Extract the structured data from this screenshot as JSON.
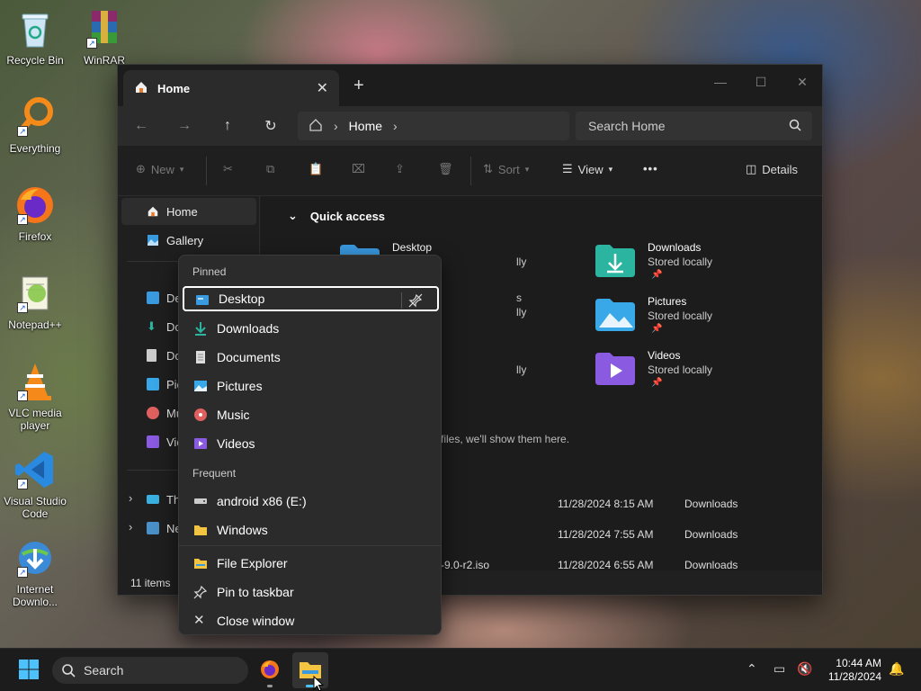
{
  "desktop": {
    "icons": [
      {
        "label": "Recycle Bin"
      },
      {
        "label": "WinRAR"
      },
      {
        "label": "Everything"
      },
      {
        "label": "Firefox"
      },
      {
        "label": "Notepad++"
      },
      {
        "label": "VLC media player"
      },
      {
        "label": "Visual Studio Code"
      },
      {
        "label": "Internet Downlo..."
      }
    ]
  },
  "explorer": {
    "tab_title": "Home",
    "new_tab": "+",
    "address_crumb": "Home",
    "search_placeholder": "Search Home",
    "toolbar": {
      "new_label": "New",
      "sort_label": "Sort",
      "view_label": "View",
      "more_label": "•••",
      "details_label": "Details"
    },
    "sidebar": {
      "home": "Home",
      "gallery": "Gallery",
      "items": [
        "De",
        "Do",
        "Do",
        "Pic",
        "Mu",
        "Vic"
      ],
      "this_pc": "Th",
      "network": "Ne"
    },
    "quick_access_label": "Quick access",
    "folders": [
      {
        "name": "Desktop",
        "sub": "lly"
      },
      {
        "name": "Downloads",
        "sub": "Stored locally"
      },
      {
        "name": "",
        "sub": "lly"
      },
      {
        "name": "Pictures",
        "sub": "Stored locally"
      },
      {
        "name": "",
        "sub": "lly"
      },
      {
        "name": "Videos",
        "sub": "Stored locally"
      }
    ],
    "partial_s": "s",
    "empty_message": "e files, we'll show them here.",
    "recent": [
      {
        "name": "",
        "date": "11/28/2024 8:15 AM",
        "location": "Downloads"
      },
      {
        "name": "",
        "date": "11/28/2024 7:55 AM",
        "location": "Downloads"
      },
      {
        "name": "-9.0-r2.iso",
        "date": "11/28/2024 6:55 AM",
        "location": "Downloads"
      }
    ],
    "status_items": "11 items"
  },
  "jumplist": {
    "pinned_header": "Pinned",
    "pinned": [
      "Desktop",
      "Downloads",
      "Documents",
      "Pictures",
      "Music",
      "Videos"
    ],
    "frequent_header": "Frequent",
    "frequent": [
      "android x86 (E:)",
      "Windows"
    ],
    "tasks": [
      "File Explorer",
      "Pin to taskbar",
      "Close window"
    ]
  },
  "taskbar": {
    "search_label": "Search",
    "time": "10:44 AM",
    "date": "11/28/2024"
  },
  "colors": {
    "accent": "#4cc2ff",
    "folder_yellow": "#f3c442",
    "downloads_teal": "#2bb5a0",
    "pictures_blue": "#38a8e8",
    "videos_purple": "#8a5ae0",
    "music_red": "#e06060"
  }
}
